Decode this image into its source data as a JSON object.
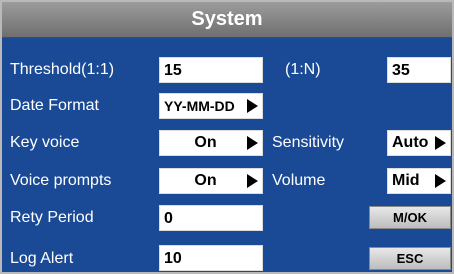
{
  "title": "System",
  "threshold_11": {
    "label": "Threshold(1:1)",
    "value": "15"
  },
  "threshold_1n": {
    "label": "(1:N)",
    "value": "35"
  },
  "date_format": {
    "label": "Date Format",
    "value": "YY-MM-DD"
  },
  "key_voice": {
    "label": "Key voice",
    "value": "On"
  },
  "sensitivity": {
    "label": "Sensitivity",
    "value": "Auto"
  },
  "voice_prompts": {
    "label": "Voice prompts",
    "value": "On"
  },
  "volume": {
    "label": "Volume",
    "value": "Mid"
  },
  "rety_period": {
    "label": "Rety Period",
    "value": "0"
  },
  "log_alert": {
    "label": "Log Alert",
    "value": "10"
  },
  "buttons": {
    "ok": "M/OK",
    "esc": "ESC"
  },
  "colors": {
    "background": "#1a4a95",
    "titlebar": "#808080",
    "field": "#ffffff"
  }
}
